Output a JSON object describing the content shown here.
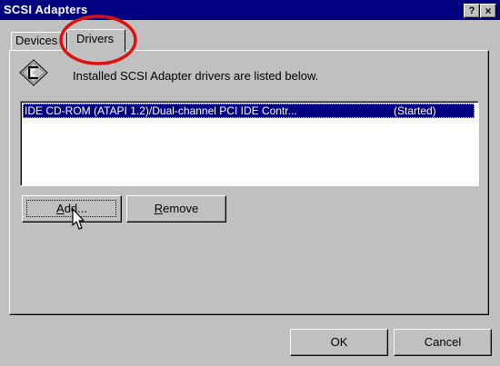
{
  "window": {
    "title": "SCSI Adapters",
    "help_label": "?",
    "close_label": "×"
  },
  "tabs": [
    {
      "label": "Devices",
      "active": false
    },
    {
      "label": "Drivers",
      "active": true
    }
  ],
  "drivers_panel": {
    "icon": "scsi-adapter-icon",
    "caption": "Installed SCSI Adapter drivers are listed below.",
    "drivers": [
      {
        "name": "IDE CD-ROM (ATAPI 1.2)/Dual-channel PCI IDE Contr...",
        "status": "(Started)",
        "selected": true
      }
    ],
    "add_button": {
      "mnemonic": "A",
      "rest": "dd..."
    },
    "remove_button": {
      "mnemonic": "R",
      "rest": "emove"
    }
  },
  "footer": {
    "ok_label": "OK",
    "cancel_label": "Cancel"
  },
  "colors": {
    "title_bar": "#000080",
    "dialog_face": "#c0c0c0",
    "selection": "#000080",
    "highlight_ellipse": "#e01010"
  }
}
